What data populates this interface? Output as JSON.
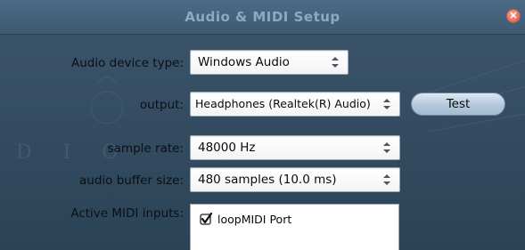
{
  "window": {
    "title": "Audio & MIDI Setup",
    "close_glyph": "×"
  },
  "colors": {
    "title_text": "#8ea9c2",
    "background": "#3d566c",
    "close_button": "#e8725f",
    "button_blue": "#b4c8db"
  },
  "audio_device_type": {
    "label": "Audio device type:",
    "value": "Windows Audio",
    "icon": "updown-chevron-icon"
  },
  "output": {
    "label": "output:",
    "value": "Headphones (Realtek(R) Audio)",
    "icon": "updown-chevron-icon",
    "test_button_label": "Test"
  },
  "sample_rate": {
    "label": "sample rate:",
    "value": "48000 Hz",
    "icon": "updown-chevron-icon"
  },
  "buffer_size": {
    "label": "audio buffer size:",
    "value": "480 samples (10.0 ms)",
    "icon": "updown-chevron-icon"
  },
  "midi_inputs": {
    "label": "Active MIDI inputs:",
    "items": [
      {
        "label": "loopMIDI Port",
        "checked": true,
        "icon": "checkbox-checked-icon"
      }
    ]
  }
}
